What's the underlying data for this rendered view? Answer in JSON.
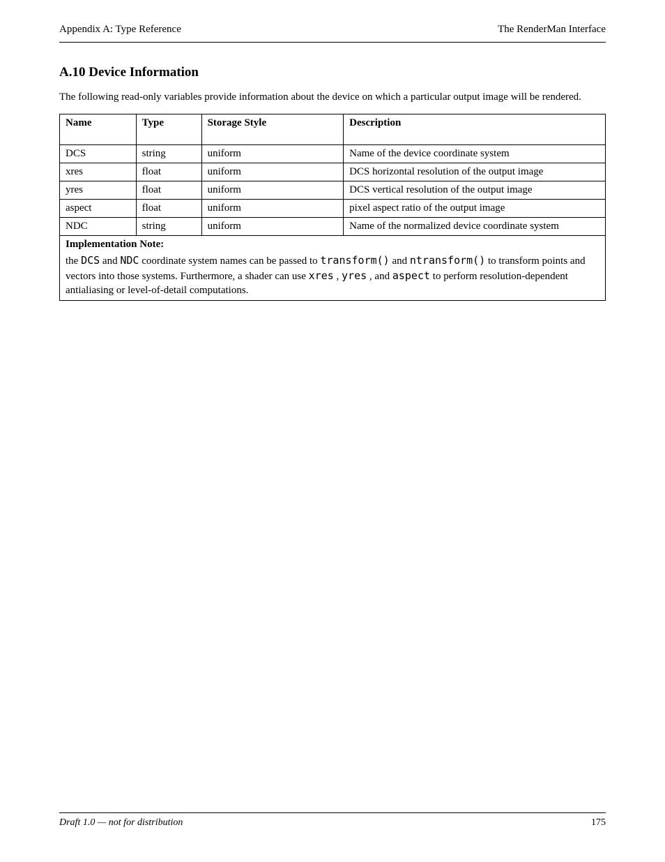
{
  "header": {
    "left": "Appendix A: Type Reference",
    "right": "The RenderMan Interface"
  },
  "footer": {
    "left": "Draft 1.0 — not for distribution",
    "right": "175"
  },
  "section": {
    "title": "A.10  Device Information",
    "intro": "The following read-only variables provide information about the device on which a particular output image will be rendered."
  },
  "table": {
    "headers": {
      "name": "Name",
      "type": "Type",
      "style": "Storage Style",
      "description": "Description"
    },
    "rows": [
      {
        "name": "DCS",
        "type": "string",
        "style": "uniform",
        "description": "Name of the device coordinate system"
      },
      {
        "name": "xres",
        "type": "float",
        "style": "uniform",
        "description": "DCS horizontal resolution of the output image"
      },
      {
        "name": "yres",
        "type": "float",
        "style": "uniform",
        "description": "DCS vertical resolution of the output image"
      },
      {
        "name": "aspect",
        "type": "float",
        "style": "uniform",
        "description": "pixel aspect ratio of the output image"
      },
      {
        "name": "NDC",
        "type": "string",
        "style": "uniform",
        "description": "Name of the normalized device coordinate system"
      }
    ],
    "note": {
      "title": "Implementation Note:",
      "body_before_code": "the ",
      "code1": "DCS",
      "body_mid1": " and ",
      "code2": "NDC",
      "body_mid2": " coordinate system names can be passed to ",
      "code3": "transform()",
      "body_mid3": " and ",
      "code4": "ntransform()",
      "body_mid4": " to transform points and vectors into those systems. Furthermore, a shader can use ",
      "code5": "xres",
      "body_mid5": ", ",
      "code6": "yres",
      "body_mid6": ", and ",
      "code7": "aspect",
      "body_after_code": " to perform resolution-dependent antialiasing or level-of-detail computations."
    }
  }
}
